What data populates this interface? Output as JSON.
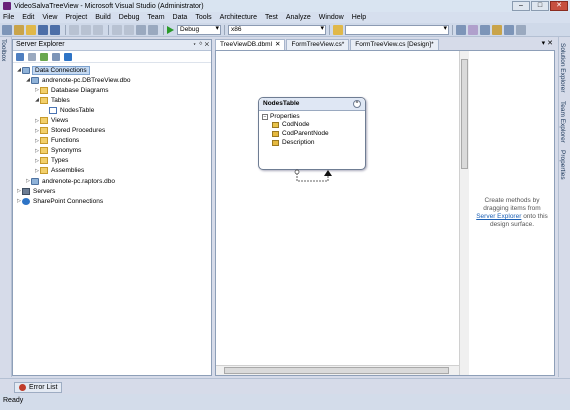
{
  "window": {
    "title": "VideoSalvaTreeView - Microsoft Visual Studio (Administrator)"
  },
  "menu": [
    "File",
    "Edit",
    "View",
    "Project",
    "Build",
    "Debug",
    "Team",
    "Data",
    "Tools",
    "Architecture",
    "Test",
    "Analyze",
    "Window",
    "Help"
  ],
  "toolbar": {
    "config_value": "Debug",
    "platform_value": "x86",
    "find_value": ""
  },
  "left_tabs": [
    "Toolbox"
  ],
  "right_tabs": [
    "Solution Explorer",
    "Team Explorer",
    "Properties"
  ],
  "server_explorer": {
    "title": "Server Explorer",
    "pane_buttons": "▾ ᛜ ✕",
    "tree": [
      {
        "label": "Data Connections",
        "level": 0,
        "icon": "db-icon",
        "expanded": true,
        "selected": true
      },
      {
        "label": "andrenote-pc.DBTreeView.dbo",
        "level": 1,
        "icon": "db-icon",
        "expanded": true
      },
      {
        "label": "Database Diagrams",
        "level": 2,
        "icon": "folder-icon",
        "expanded": false
      },
      {
        "label": "Tables",
        "level": 2,
        "icon": "folder-icon",
        "expanded": true
      },
      {
        "label": "NodesTable",
        "level": 3,
        "icon": "table-icon",
        "expanded": null
      },
      {
        "label": "Views",
        "level": 2,
        "icon": "folder-icon",
        "expanded": false
      },
      {
        "label": "Stored Procedures",
        "level": 2,
        "icon": "folder-icon",
        "expanded": false
      },
      {
        "label": "Functions",
        "level": 2,
        "icon": "folder-icon",
        "expanded": false
      },
      {
        "label": "Synonyms",
        "level": 2,
        "icon": "folder-icon",
        "expanded": false
      },
      {
        "label": "Types",
        "level": 2,
        "icon": "folder-icon",
        "expanded": false
      },
      {
        "label": "Assemblies",
        "level": 2,
        "icon": "folder-icon",
        "expanded": false
      },
      {
        "label": "andrenote-pc.raptors.dbo",
        "level": 1,
        "icon": "db-icon",
        "expanded": false
      },
      {
        "label": "Servers",
        "level": 0,
        "icon": "server-icon",
        "expanded": false
      },
      {
        "label": "SharePoint Connections",
        "level": 0,
        "icon": "sharepoint-icon",
        "expanded": false
      }
    ]
  },
  "tabs": [
    {
      "label": "TreeViewDB.dbml",
      "active": true,
      "close": "✕"
    },
    {
      "label": "FormTreeView.cs*",
      "active": false,
      "close": ""
    },
    {
      "label": "FormTreeView.cs [Design]*",
      "active": false,
      "close": ""
    }
  ],
  "tabs_right": "▾ ✕",
  "entity": {
    "name": "NodesTable",
    "collapse_glyph": "⌃",
    "section": "Properties",
    "section_glyph": "−",
    "properties": [
      {
        "name": "CodNode",
        "key": true
      },
      {
        "name": "CodParentNode",
        "key": false
      },
      {
        "name": "Description",
        "key": false
      }
    ]
  },
  "methods_pane": {
    "line1": "Create methods by",
    "line2": "dragging items from",
    "link": "Server Explorer",
    "line3": "onto this",
    "line4": "design surface."
  },
  "bottom_tab": "Error List",
  "status": "Ready",
  "colors": {
    "accent": "#68217a",
    "selection": "#c4d9f2",
    "link": "#1a5fb4",
    "chrome": "#d6dbe9"
  }
}
